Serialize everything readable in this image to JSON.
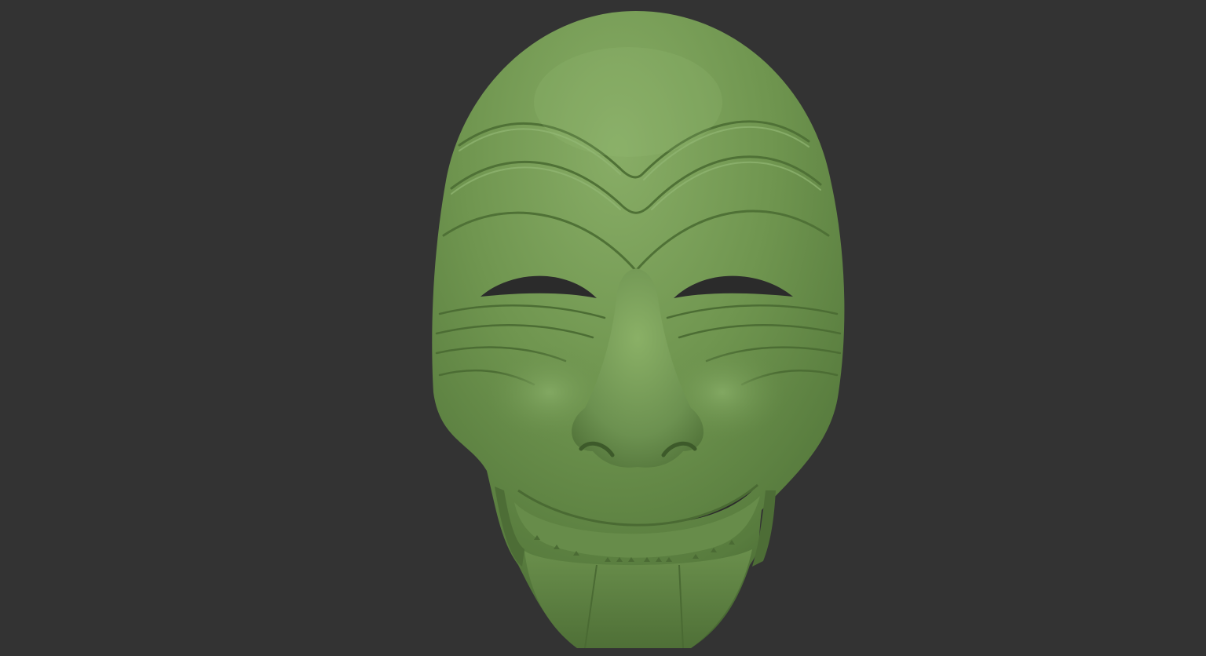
{
  "scene": {
    "background_color": "#333333",
    "subject": "mask-model",
    "material_color": "#6f9a52",
    "highlight_color": "#8fb56e",
    "shadow_color": "#3e5a2c"
  }
}
